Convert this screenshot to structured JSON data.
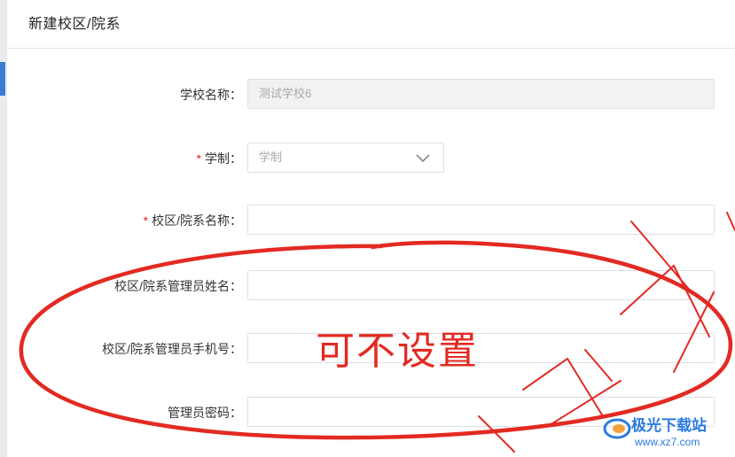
{
  "dialog": {
    "title": "新建校区/院系"
  },
  "form": {
    "school_name": {
      "label": "学校名称：",
      "value": "测试学校6"
    },
    "school_system": {
      "required_mark": "*",
      "label": "学制：",
      "placeholder": "学制"
    },
    "campus_name": {
      "required_mark": "*",
      "label": "校区/院系名称：",
      "value": ""
    },
    "admin_name": {
      "label": "校区/院系管理员姓名：",
      "value": ""
    },
    "admin_phone": {
      "label": "校区/院系管理员手机号：",
      "value": ""
    },
    "admin_password": {
      "label": "管理员密码：",
      "value": ""
    }
  },
  "annotation": {
    "text": "可不设置",
    "color": "#e22a22"
  },
  "watermark": {
    "brand": "极光下载站",
    "url": "www.xz7.com",
    "color": "#2b7be0"
  },
  "icons": {
    "select_arrow": "chevron-down-icon"
  }
}
